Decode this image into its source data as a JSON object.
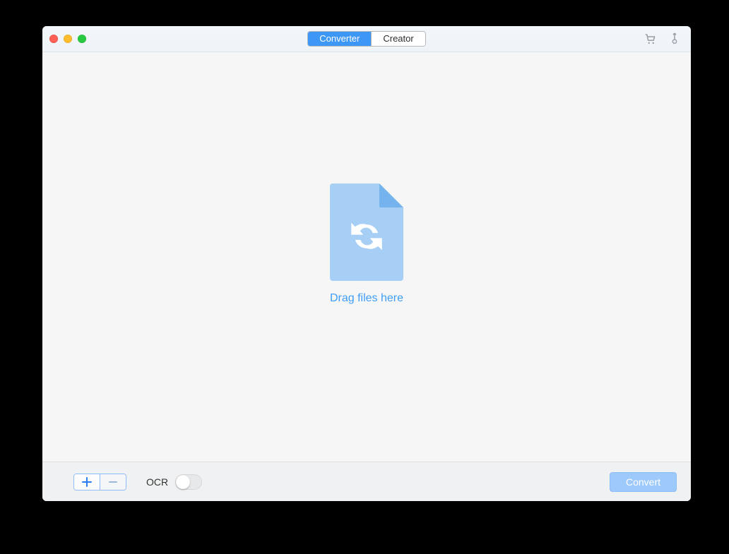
{
  "tabs": {
    "converter": "Converter",
    "creator": "Creator"
  },
  "drop": {
    "label": "Drag files here"
  },
  "footer": {
    "ocr_label": "OCR",
    "ocr_on": false,
    "convert_label": "Convert"
  },
  "colors": {
    "accent": "#3d97f7"
  }
}
